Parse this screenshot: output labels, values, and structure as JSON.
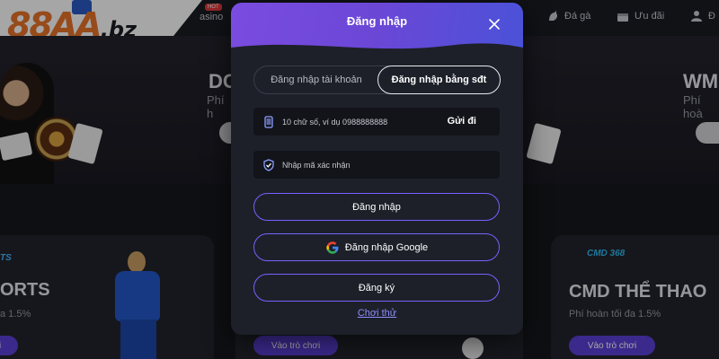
{
  "header": {
    "logo_text": "88AA",
    "logo_suffix": ".bz",
    "nav_partial": "asino",
    "hot_badge": "HOT",
    "nav_items": [
      {
        "icon": "rooster-icon",
        "label": "Đá gà"
      },
      {
        "icon": "gift-icon",
        "label": "Ưu đãi"
      },
      {
        "icon": "user-icon",
        "label": "Đ"
      }
    ]
  },
  "background": {
    "banner_left": {
      "title": "DC",
      "sub": "Phí h"
    },
    "banner_right": {
      "title": "WM",
      "sub": "Phí hoà"
    },
    "panel_left": {
      "tag": "TS",
      "title": "ORTS",
      "sub": "a 1.5%",
      "button": "i"
    },
    "panel_mid": {
      "button": "Vào trò chơi"
    },
    "panel_right": {
      "logo": "CMD 368",
      "title": "CMD THỂ THAO",
      "sub": "Phí hoàn tối đa 1.5%",
      "button": "Vào trò chơi"
    }
  },
  "modal": {
    "title": "Đăng nhập",
    "tabs": [
      "Đăng nhập tài khoản",
      "Đăng nhập bằng sđt"
    ],
    "active_tab": 1,
    "phone_placeholder": "10 chữ số, ví dụ 0988888888",
    "send_code": "Gửi đi",
    "otp_placeholder": "Nhập mã xác nhận",
    "login_button": "Đăng nhập",
    "google_button": "Đăng nhập Google",
    "register_button": "Đăng ký",
    "try_link": "Chơi thử"
  },
  "colors": {
    "accent": "#7363ff",
    "brand_orange": "#e8742a",
    "header_gradient_start": "#7a4ce0",
    "header_gradient_end": "#4a52d8",
    "play_button": "#5b40d8"
  }
}
